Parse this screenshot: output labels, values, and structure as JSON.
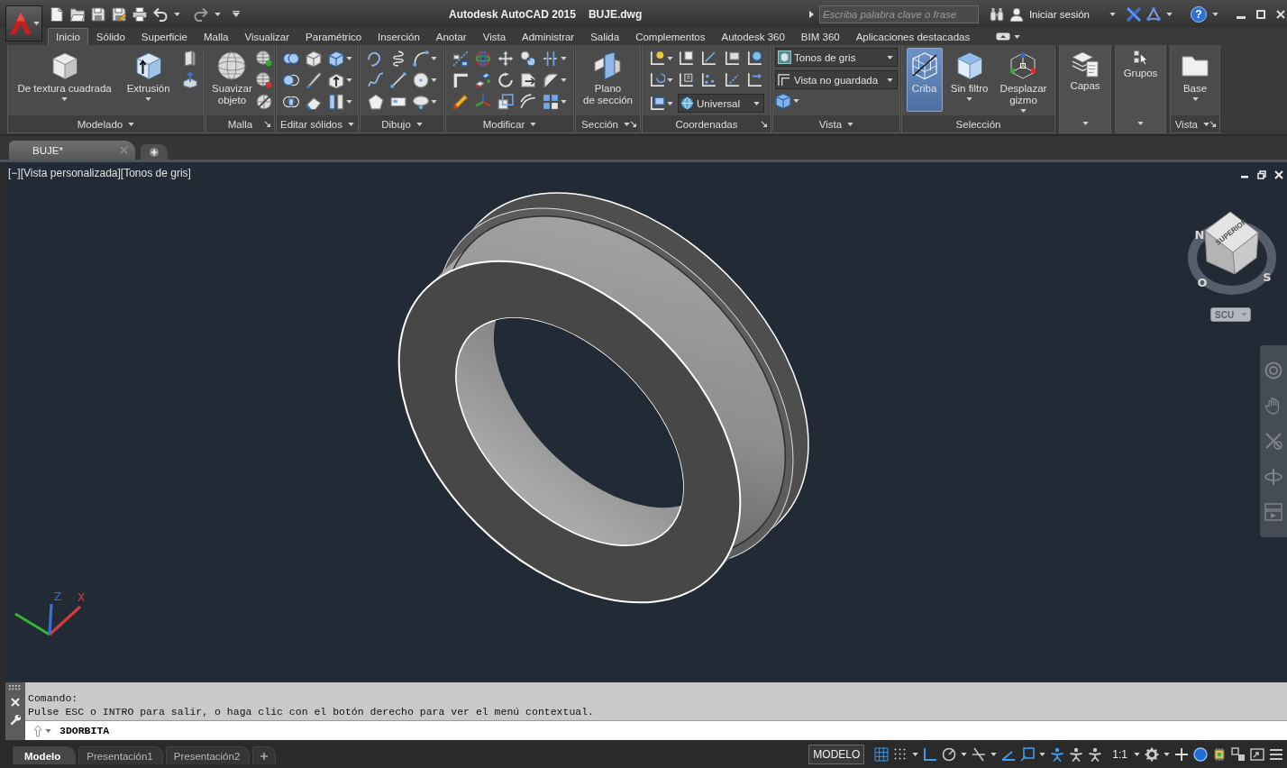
{
  "title_bar": {
    "title": "Autodesk AutoCAD 2015",
    "file": "BUJE.dwg",
    "search": {
      "placeholder": "Escriba palabra clave o frase"
    },
    "sign_in": "Iniciar sesión",
    "help": "?"
  },
  "ribbon_tabs": [
    {
      "label": "Inicio",
      "selected": true
    },
    {
      "label": "Sólido",
      "selected": false
    },
    {
      "label": "Superficie",
      "selected": false
    },
    {
      "label": "Malla",
      "selected": false
    },
    {
      "label": "Visualizar",
      "selected": false
    },
    {
      "label": "Paramétrico",
      "selected": false
    },
    {
      "label": "Inserción",
      "selected": false
    },
    {
      "label": "Anotar",
      "selected": false
    },
    {
      "label": "Vista",
      "selected": false
    },
    {
      "label": "Administrar",
      "selected": false
    },
    {
      "label": "Salida",
      "selected": false
    },
    {
      "label": "Complementos",
      "selected": false
    },
    {
      "label": "Autodesk 360",
      "selected": false
    },
    {
      "label": "BIM 360",
      "selected": false
    },
    {
      "label": "Aplicaciones destacadas",
      "selected": false
    }
  ],
  "ribbon_panels": [
    {
      "kind": "full",
      "title": "Modelado",
      "dropdown": true,
      "launcher": false,
      "buttons": [
        {
          "lines": [
            "De textura cuadrada"
          ],
          "caret": true,
          "on": false
        },
        {
          "lines": [
            "Extrusión"
          ],
          "caret": true,
          "on": false
        }
      ]
    },
    {
      "kind": "full",
      "title": "Malla",
      "dropdown": false,
      "launcher": true,
      "buttons": [
        {
          "lines": [
            "Suavizar",
            "objeto"
          ],
          "caret": false,
          "on": false
        }
      ]
    },
    {
      "kind": "full",
      "title": "Editar sólidos",
      "dropdown": true,
      "launcher": false
    },
    {
      "kind": "full",
      "title": "Dibujo",
      "dropdown": true,
      "launcher": false
    },
    {
      "kind": "full",
      "title": "Modificar",
      "dropdown": true,
      "launcher": false
    },
    {
      "kind": "full",
      "title": "Sección",
      "dropdown": true,
      "launcher": true,
      "buttons": [
        {
          "lines": [
            "Plano",
            "de sección"
          ],
          "caret": false,
          "on": false
        }
      ]
    },
    {
      "kind": "full",
      "title": "Coordenadas",
      "dropdown": false,
      "launcher": true,
      "combos": [
        {
          "value": "Universal"
        }
      ]
    },
    {
      "kind": "full",
      "title": "Vista",
      "dropdown": true,
      "launcher": false,
      "combos": [
        {
          "value": "Tonos de gris"
        },
        {
          "value": "Vista no guardada"
        }
      ]
    },
    {
      "kind": "full",
      "title": "Selección",
      "dropdown": false,
      "launcher": false,
      "buttons": [
        {
          "lines": [
            "Criba"
          ],
          "caret": false,
          "on": true
        },
        {
          "lines": [
            "Sin filtro"
          ],
          "caret": true,
          "on": false
        },
        {
          "lines": [
            "Desplazar",
            "gizmo"
          ],
          "caret": true,
          "on": false
        }
      ]
    },
    {
      "kind": "collapsed",
      "lines": [
        "Capas"
      ]
    },
    {
      "kind": "collapsed",
      "lines": [
        "Grupos"
      ]
    },
    {
      "kind": "full",
      "title": "Vista",
      "dropdown": true,
      "launcher": true,
      "buttons": [
        {
          "lines": [
            "Base"
          ],
          "caret": true,
          "on": false
        }
      ]
    }
  ],
  "document_tabs": [
    {
      "label": "BUJE*",
      "selected": true
    }
  ],
  "viewport": {
    "label": "[−][Vista personalizada][Tonos de gris]",
    "view_cube": {
      "face": "SUPERIOR",
      "compass": [
        "N",
        "O",
        "S"
      ],
      "ucs_menu": "SCU"
    },
    "ucs_icon": {
      "labels": [
        "Z",
        "X"
      ]
    }
  },
  "command_line": {
    "history": [
      "Comando:",
      "Pulse ESC o INTRO para salir, o haga clic con el botón derecho para ver el menú contextual."
    ],
    "input": "3DORBITA"
  },
  "layout_tabs": [
    {
      "label": "Modelo",
      "selected": true
    },
    {
      "label": "Presentación1",
      "selected": false
    },
    {
      "label": "Presentación2",
      "selected": false
    }
  ],
  "status_bar": {
    "space": "MODELO",
    "toggles": [
      {
        "on": true
      },
      {
        "on": false
      },
      {
        "on": true
      },
      {
        "on": false
      },
      {
        "on": false
      },
      {
        "on": true
      },
      {
        "on": true
      },
      {
        "on": true
      },
      {
        "on": false
      },
      {
        "on": false
      }
    ],
    "scale": "1:1"
  }
}
